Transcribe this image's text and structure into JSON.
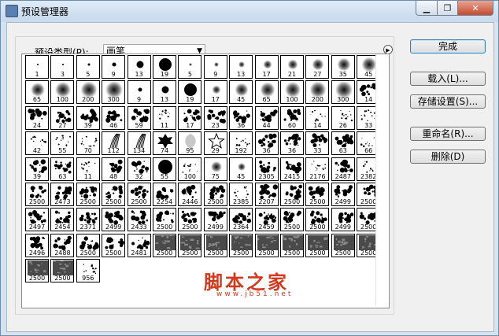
{
  "window": {
    "title": "预设管理器",
    "min_glyph": "▁",
    "max_glyph": "❐",
    "close_glyph": "✕"
  },
  "preset": {
    "label": "预设类型(P):",
    "value": "画笔",
    "arrow": "▼",
    "flyout_glyph": "▶"
  },
  "buttons": {
    "done": "完成",
    "load": "载入(L)...",
    "save": "存储设置(S)...",
    "rename": "重命名(R)...",
    "delete": "删除(D)"
  },
  "watermark": {
    "text": "脚本之家",
    "url": "www.jb51.net"
  },
  "brush_list": {
    "selected_index": 154,
    "cells": [
      {
        "size": "1",
        "kind": "hard",
        "dia": 2
      },
      {
        "size": "3",
        "kind": "hard",
        "dia": 2
      },
      {
        "size": "5",
        "kind": "hard",
        "dia": 3
      },
      {
        "size": "9",
        "kind": "hard",
        "dia": 5
      },
      {
        "size": "13",
        "kind": "hard",
        "dia": 9
      },
      {
        "size": "19",
        "kind": "hard",
        "dia": 16
      },
      {
        "size": "5",
        "kind": "soft",
        "dia": 4
      },
      {
        "size": "9",
        "kind": "soft",
        "dia": 6
      },
      {
        "size": "13",
        "kind": "soft",
        "dia": 8
      },
      {
        "size": "17",
        "kind": "soft",
        "dia": 11
      },
      {
        "size": "21",
        "kind": "soft",
        "dia": 13
      },
      {
        "size": "27",
        "kind": "soft",
        "dia": 15
      },
      {
        "size": "35",
        "kind": "soft",
        "dia": 17
      },
      {
        "size": "45",
        "kind": "soft",
        "dia": 19
      },
      {
        "size": "65",
        "kind": "soft",
        "dia": 18
      },
      {
        "size": "100",
        "kind": "soft",
        "dia": 20
      },
      {
        "size": "200",
        "kind": "soft",
        "dia": 21
      },
      {
        "size": "300",
        "kind": "soft",
        "dia": 22
      },
      {
        "size": "9",
        "kind": "hard",
        "dia": 5
      },
      {
        "size": "13",
        "kind": "hard",
        "dia": 9
      },
      {
        "size": "19",
        "kind": "hard",
        "dia": 16
      },
      {
        "size": "17",
        "kind": "soft",
        "dia": 11
      },
      {
        "size": "45",
        "kind": "soft",
        "dia": 17
      },
      {
        "size": "65",
        "kind": "soft",
        "dia": 19
      },
      {
        "size": "100",
        "kind": "soft",
        "dia": 20
      },
      {
        "size": "200",
        "kind": "soft",
        "dia": 21
      },
      {
        "size": "300",
        "kind": "soft",
        "dia": 22
      },
      {
        "size": "14",
        "kind": "splat"
      },
      {
        "size": "24",
        "kind": "splat"
      },
      {
        "size": "27",
        "kind": "splat"
      },
      {
        "size": "39",
        "kind": "splat"
      },
      {
        "size": "46",
        "kind": "splat"
      },
      {
        "size": "59",
        "kind": "splat"
      },
      {
        "size": "11",
        "kind": "dots"
      },
      {
        "size": "17",
        "kind": "splat"
      },
      {
        "size": "23",
        "kind": "splat"
      },
      {
        "size": "36",
        "kind": "splat"
      },
      {
        "size": "44",
        "kind": "splat"
      },
      {
        "size": "60",
        "kind": "splat"
      },
      {
        "size": "14",
        "kind": "dots"
      },
      {
        "size": "26",
        "kind": "dots"
      },
      {
        "size": "33",
        "kind": "dots"
      },
      {
        "size": "42",
        "kind": "dots"
      },
      {
        "size": "55",
        "kind": "dots"
      },
      {
        "size": "70",
        "kind": "dots"
      },
      {
        "size": "112",
        "kind": "grass"
      },
      {
        "size": "134",
        "kind": "grass"
      },
      {
        "size": "74",
        "kind": "leaf"
      },
      {
        "size": "95",
        "kind": "leafsoft"
      },
      {
        "size": "29",
        "kind": "star"
      },
      {
        "size": "192",
        "kind": "dots"
      },
      {
        "size": "36",
        "kind": "splat"
      },
      {
        "size": "36",
        "kind": "splat"
      },
      {
        "size": "33",
        "kind": "splat"
      },
      {
        "size": "63",
        "kind": "splat"
      },
      {
        "size": "66",
        "kind": "dots"
      },
      {
        "size": "39",
        "kind": "splat"
      },
      {
        "size": "63",
        "kind": "splat"
      },
      {
        "size": "11",
        "kind": "dots"
      },
      {
        "size": "48",
        "kind": "splat"
      },
      {
        "size": "32",
        "kind": "splat"
      },
      {
        "size": "55",
        "kind": "hard",
        "dia": 18
      },
      {
        "size": "100",
        "kind": "dots"
      },
      {
        "size": "75",
        "kind": "soft",
        "dia": 14
      },
      {
        "size": "45",
        "kind": "soft",
        "dia": 10
      },
      {
        "size": "2305",
        "kind": "splat"
      },
      {
        "size": "2415",
        "kind": "splat"
      },
      {
        "size": "2176",
        "kind": "dots"
      },
      {
        "size": "2487",
        "kind": "splat"
      },
      {
        "size": "2382",
        "kind": "dots"
      },
      {
        "size": "2500",
        "kind": "splat"
      },
      {
        "size": "2473",
        "kind": "splat"
      },
      {
        "size": "2500",
        "kind": "splat"
      },
      {
        "size": "2500",
        "kind": "splat"
      },
      {
        "size": "2500",
        "kind": "splat"
      },
      {
        "size": "2254",
        "kind": "splat"
      },
      {
        "size": "2446",
        "kind": "splat"
      },
      {
        "size": "2500",
        "kind": "splat"
      },
      {
        "size": "2385",
        "kind": "dots"
      },
      {
        "size": "2207",
        "kind": "splat"
      },
      {
        "size": "2500",
        "kind": "splat"
      },
      {
        "size": "2500",
        "kind": "splat"
      },
      {
        "size": "2499",
        "kind": "splat"
      },
      {
        "size": "2500",
        "kind": "splat"
      },
      {
        "size": "2497",
        "kind": "splat"
      },
      {
        "size": "2454",
        "kind": "splat"
      },
      {
        "size": "2371",
        "kind": "splat"
      },
      {
        "size": "2499",
        "kind": "splat"
      },
      {
        "size": "2433",
        "kind": "splat"
      },
      {
        "size": "2500",
        "kind": "splat"
      },
      {
        "size": "2500",
        "kind": "splat"
      },
      {
        "size": "2499",
        "kind": "splat"
      },
      {
        "size": "2364",
        "kind": "splat"
      },
      {
        "size": "2459",
        "kind": "splat"
      },
      {
        "size": "2500",
        "kind": "splat"
      },
      {
        "size": "2500",
        "kind": "splat"
      },
      {
        "size": "2499",
        "kind": "splat"
      },
      {
        "size": "2500",
        "kind": "splat"
      },
      {
        "size": "2496",
        "kind": "splat"
      },
      {
        "size": "2488",
        "kind": "splat"
      },
      {
        "size": "2500",
        "kind": "splat"
      },
      {
        "size": "2500",
        "kind": "splat"
      },
      {
        "size": "2481",
        "kind": "splat"
      },
      {
        "size": "2500",
        "kind": "texture"
      },
      {
        "size": "2500",
        "kind": "texture"
      },
      {
        "size": "2500",
        "kind": "texture"
      },
      {
        "size": "2500",
        "kind": "texture"
      },
      {
        "size": "2500",
        "kind": "texture"
      },
      {
        "size": "2500",
        "kind": "texture"
      },
      {
        "size": "2500",
        "kind": "texture"
      },
      {
        "size": "2500",
        "kind": "texture"
      },
      {
        "size": "2500",
        "kind": "texture"
      },
      {
        "size": "2500",
        "kind": "texture"
      },
      {
        "size": "2500",
        "kind": "texture"
      },
      {
        "size": "956",
        "kind": "dots"
      }
    ]
  }
}
